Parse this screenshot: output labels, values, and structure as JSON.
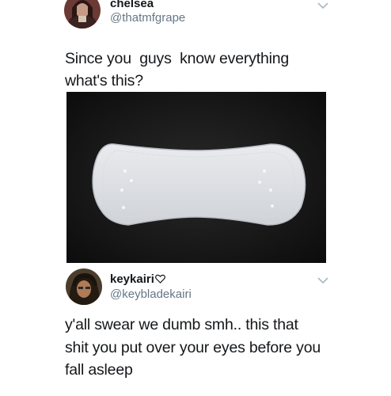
{
  "tweet1": {
    "name": "chelsea",
    "handle": "@thatmfgrape",
    "text_line1": "Since you  guys  know everything",
    "text_line2": "what's this?",
    "image_icon": "panty-liner-photo",
    "menu_icon": "chevron-down-icon"
  },
  "tweet2": {
    "name": "keykairi",
    "handle": "@keybladekairi",
    "badge_icon": "heart-outline-icon",
    "text_line1": "y'all swear we dumb smh.. this that",
    "text_line2": "shit you put over your eyes before you",
    "text_line3": "fall asleep",
    "menu_icon": "chevron-down-icon"
  },
  "colors": {
    "text": "#14171a",
    "secondary": "#657786",
    "chevron": "#aab8c2"
  }
}
